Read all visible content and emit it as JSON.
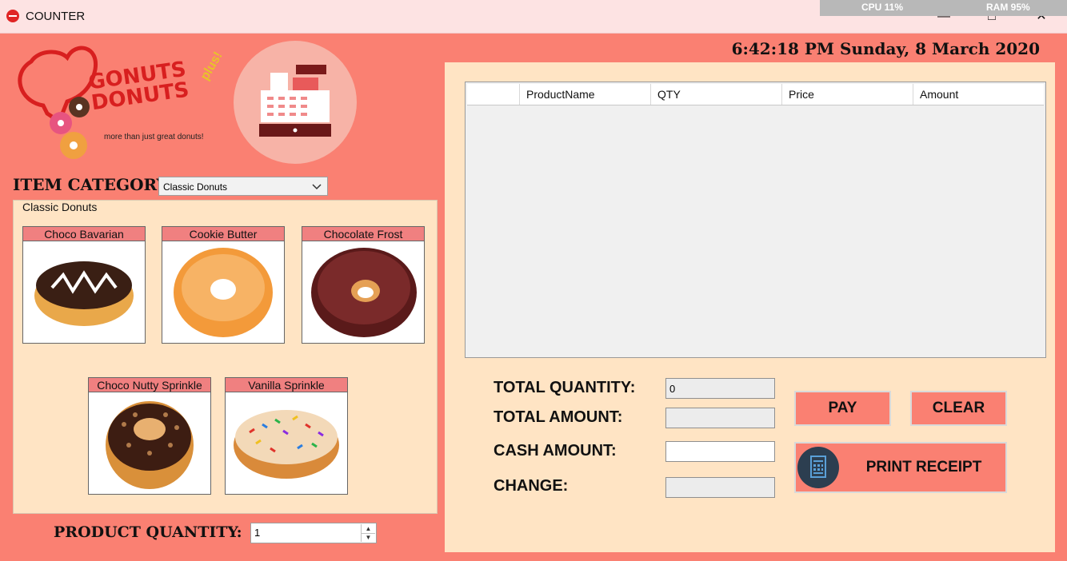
{
  "window": {
    "title": "COUNTER",
    "app_icon": "app-logo-icon",
    "controls": {
      "minimize": "—",
      "maximize": "□",
      "close": "✕"
    }
  },
  "system_monitor": {
    "cpu_label": "CPU  11%",
    "ram_label": "RAM  95%"
  },
  "datetime": "6:42:18 PM Sunday, 8 March 2020",
  "logo": {
    "line1": "GONUTS",
    "line2": "DONUTS",
    "plus": "plus!",
    "tagline": "more than just great donuts!"
  },
  "register_icon": "cash-register-icon",
  "category": {
    "label": "ITEM CATEGORY:",
    "selected": "Classic Donuts"
  },
  "group": {
    "title": "Classic Donuts"
  },
  "products": [
    {
      "name": "Choco Bavarian"
    },
    {
      "name": "Cookie Butter"
    },
    {
      "name": "Chocolate Frost"
    },
    {
      "name": "Choco Nutty Sprinkle"
    },
    {
      "name": "Vanilla Sprinkle"
    }
  ],
  "quantity": {
    "label": "PRODUCT QUANTITY:",
    "value": "1"
  },
  "order_grid": {
    "columns": [
      "",
      "ProductName",
      "QTY",
      "Price",
      "Amount"
    ],
    "rows": []
  },
  "summary": {
    "total_quantity_label": "TOTAL QUANTITY:",
    "total_quantity_value": "0",
    "total_amount_label": "TOTAL AMOUNT:",
    "total_amount_value": "",
    "cash_amount_label": "CASH AMOUNT:",
    "cash_amount_value": "",
    "change_label": "CHANGE:",
    "change_value": ""
  },
  "buttons": {
    "pay": "PAY",
    "clear": "CLEAR",
    "print_receipt": "PRINT RECEIPT",
    "print_icon": "receipt-icon"
  },
  "colors": {
    "salmon": "#fa8072",
    "bisque": "#ffe4c4",
    "label_pink": "#f08080",
    "titlebar": "#fde3e3"
  }
}
